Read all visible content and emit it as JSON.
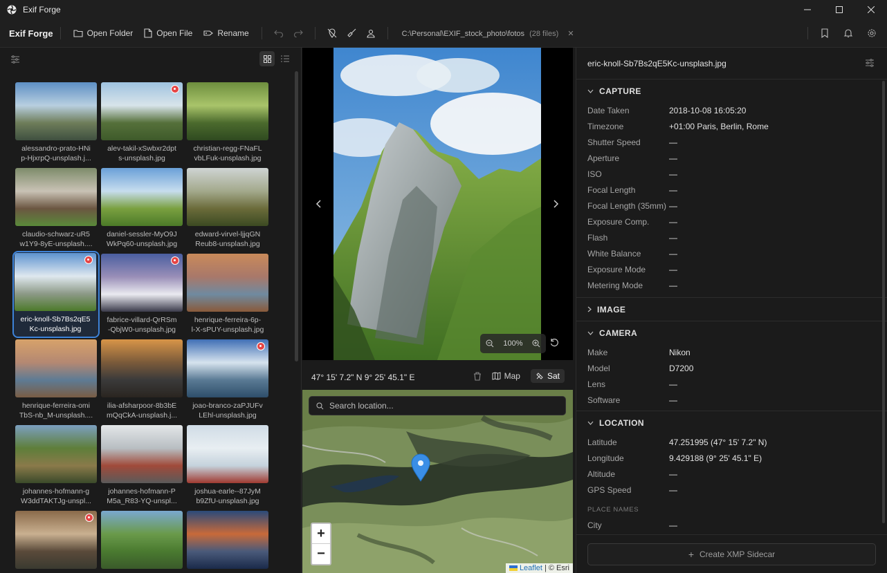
{
  "window": {
    "title": "Exif Forge"
  },
  "toolbar": {
    "brand": "Exif Forge",
    "open_folder": "Open Folder",
    "open_file": "Open File",
    "rename": "Rename",
    "path": "C:\\Personal\\EXIF_stock_photo\\fotos",
    "file_count": "(28 files)"
  },
  "thumbnails": [
    {
      "name": "alessandro-prato-HNi\np-HjxrpQ-unsplash.j...",
      "pin": false,
      "selected": false,
      "colors": [
        "#5d8fc4",
        "#b8cfe0",
        "#6e7d5a",
        "#3f5040"
      ]
    },
    {
      "name": "alev-takil-xSwbxr2dpt\ns-unsplash.jpg",
      "pin": true,
      "selected": false,
      "colors": [
        "#9fc3e0",
        "#d8e4ea",
        "#55703a",
        "#3e5a2a"
      ]
    },
    {
      "name": "christian-regg-FNaFL\nvbLFuk-unsplash.jpg",
      "pin": false,
      "selected": false,
      "colors": [
        "#6d8e3e",
        "#a9c46a",
        "#4b6a2d",
        "#2f4a20"
      ]
    },
    {
      "name": "claudio-schwarz-uR5\nw1Y9-8yE-unsplash....",
      "pin": false,
      "selected": false,
      "colors": [
        "#7d8b6a",
        "#c9c2b5",
        "#6b5641",
        "#5a8a3a"
      ]
    },
    {
      "name": "daniel-sessler-MyO9J\nWkPq60-unsplash.jpg",
      "pin": false,
      "selected": false,
      "colors": [
        "#6aa0d8",
        "#c7ddee",
        "#7aa040",
        "#4b7a28"
      ]
    },
    {
      "name": "edward-virvel-ljjqGN\nReub8-unsplash.jpg",
      "pin": false,
      "selected": false,
      "colors": [
        "#cfd4d3",
        "#a3a98c",
        "#6b6b3a",
        "#3b4a22"
      ]
    },
    {
      "name": "eric-knoll-Sb7Bs2qE5\nKc-unsplash.jpg",
      "pin": true,
      "selected": true,
      "colors": [
        "#5d93d0",
        "#dfe8ef",
        "#8d9a88",
        "#4c7a2a"
      ]
    },
    {
      "name": "fabrice-villard-QrRSm\n-QbjW0-unsplash.jpg",
      "pin": true,
      "selected": false,
      "colors": [
        "#4a5ea0",
        "#9a8fb8",
        "#eaeaf0",
        "#3a3a4a"
      ]
    },
    {
      "name": "henrique-ferreira-6p-\nl-X-sPUY-unsplash.jpg",
      "pin": false,
      "selected": false,
      "colors": [
        "#c98a5a",
        "#a8786a",
        "#6f8aa0",
        "#8a5a3a"
      ]
    },
    {
      "name": "henrique-ferreira-omi\nTbS-nb_M-unsplash....",
      "pin": false,
      "selected": false,
      "colors": [
        "#d7a26a",
        "#b48872",
        "#5e7b94",
        "#7a5d44"
      ]
    },
    {
      "name": "ilia-afsharpoor-8b3bE\nmQqCkA-unsplash.j...",
      "pin": false,
      "selected": false,
      "colors": [
        "#d89548",
        "#7a5a3a",
        "#3a3a3a",
        "#2a2520"
      ]
    },
    {
      "name": "joao-branco-zaPJUFv\nLEhl-unsplash.jpg",
      "pin": true,
      "selected": false,
      "colors": [
        "#3f6fb5",
        "#d6e3ee",
        "#5a7a94",
        "#2e4e6a"
      ]
    },
    {
      "name": "johannes-hofmann-g\nW3ddTAKTJg-unspl...",
      "pin": false,
      "selected": false,
      "colors": [
        "#7ca0c0",
        "#5e7e3a",
        "#8a7a4a",
        "#3a4a2a"
      ]
    },
    {
      "name": "johannes-hofmann-P\nM5a_R83-YQ-unspl...",
      "pin": false,
      "selected": false,
      "colors": [
        "#e3e6e8",
        "#b8bec2",
        "#a04a3a",
        "#5a5a5a"
      ]
    },
    {
      "name": "joshua-earle--87JyM\nb9ZfU-unsplash.jpg",
      "pin": false,
      "selected": false,
      "colors": [
        "#d0dce6",
        "#e8eef2",
        "#c5d2dc",
        "#a03a30"
      ]
    },
    {
      "name": "",
      "pin": true,
      "selected": false,
      "colors": [
        "#8a6a4a",
        "#c9b090",
        "#5a4a3a",
        "#3a3a30"
      ]
    },
    {
      "name": "",
      "pin": false,
      "selected": false,
      "colors": [
        "#7aa8d0",
        "#6a9a4a",
        "#4a7a30",
        "#3a5a2a"
      ]
    },
    {
      "name": "",
      "pin": false,
      "selected": false,
      "colors": [
        "#2a4a7a",
        "#c86a3a",
        "#4a5a7a",
        "#1a2a4a"
      ]
    }
  ],
  "preview": {
    "zoom": "100%"
  },
  "map": {
    "coords": "47° 15' 7.2\" N 9° 25' 45.1\" E",
    "map_label": "Map",
    "sat_label": "Sat",
    "search_placeholder": "Search location...",
    "zoom_in": "+",
    "zoom_out": "−",
    "attribution_leaflet": "Leaflet",
    "attribution_rest": "| © Esri"
  },
  "details": {
    "filename": "eric-knoll-Sb7Bs2qE5Kc-unsplash.jpg",
    "capture": {
      "title": "CAPTURE",
      "rows": [
        {
          "k": "Date Taken",
          "v": "2018-10-08  16:05:20"
        },
        {
          "k": "Timezone",
          "v": "+01:00 Paris, Berlin, Rome"
        },
        {
          "k": "Shutter Speed",
          "v": "—"
        },
        {
          "k": "Aperture",
          "v": "—"
        },
        {
          "k": "ISO",
          "v": "—"
        },
        {
          "k": "Focal Length",
          "v": "—"
        },
        {
          "k": "Focal Length (35mm)",
          "v": "—"
        },
        {
          "k": "Exposure Comp.",
          "v": "—"
        },
        {
          "k": "Flash",
          "v": "—"
        },
        {
          "k": "White Balance",
          "v": "—"
        },
        {
          "k": "Exposure Mode",
          "v": "—"
        },
        {
          "k": "Metering Mode",
          "v": "—"
        }
      ]
    },
    "image": {
      "title": "IMAGE"
    },
    "camera": {
      "title": "CAMERA",
      "rows": [
        {
          "k": "Make",
          "v": "Nikon"
        },
        {
          "k": "Model",
          "v": "D7200"
        },
        {
          "k": "Lens",
          "v": "—"
        },
        {
          "k": "Software",
          "v": "—"
        }
      ]
    },
    "location": {
      "title": "LOCATION",
      "rows": [
        {
          "k": "Latitude",
          "v": "47.251995  (47° 15' 7.2\" N)"
        },
        {
          "k": "Longitude",
          "v": "9.429188  (9° 25' 45.1\" E)"
        },
        {
          "k": "Altitude",
          "v": "—"
        },
        {
          "k": "GPS Speed",
          "v": "—"
        }
      ],
      "place_names": "PLACE NAMES",
      "city": {
        "k": "City",
        "v": "—"
      }
    },
    "create_xmp": "Create XMP Sidecar"
  },
  "colors": {
    "accent": "#3d83d9",
    "pin": "#e64545",
    "map_pin": "#3a8ee6"
  }
}
